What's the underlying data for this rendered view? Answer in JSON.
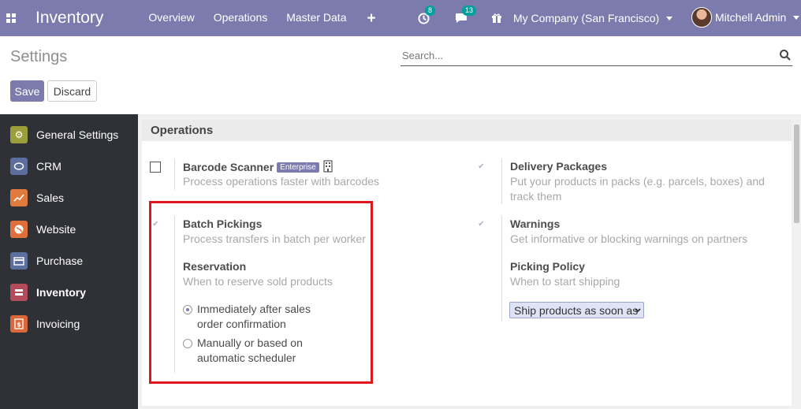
{
  "navbar": {
    "app_title": "Inventory",
    "menu": [
      "Overview",
      "Operations",
      "Master Data"
    ],
    "plus": "+",
    "activity_count": "8",
    "messages_count": "13",
    "company": "My Company (San Francisco)",
    "user": "Mitchell Admin",
    "color": "#7c7bad"
  },
  "control": {
    "title": "Settings",
    "search_placeholder": "Search...",
    "save": "Save",
    "discard": "Discard"
  },
  "sidebar": {
    "items": [
      {
        "label": "General Settings",
        "icon": "gear-icon",
        "color": "#9a9f3c"
      },
      {
        "label": "CRM",
        "icon": "handshake-icon",
        "color": "#5b6e9e"
      },
      {
        "label": "Sales",
        "icon": "chart-icon",
        "color": "#e07b3d"
      },
      {
        "label": "Website",
        "icon": "globe-icon",
        "color": "#e0703b"
      },
      {
        "label": "Purchase",
        "icon": "card-icon",
        "color": "#5a6f9d"
      },
      {
        "label": "Inventory",
        "icon": "boxes-icon",
        "color": "#b34b5b"
      },
      {
        "label": "Invoicing",
        "icon": "dollar-icon",
        "color": "#d9683a"
      }
    ]
  },
  "section": {
    "title": "Operations",
    "barcode": {
      "label": "Barcode Scanner",
      "badge": "Enterprise",
      "desc": "Process operations faster with barcodes",
      "checked": false
    },
    "delivery": {
      "label": "Delivery Packages",
      "desc": "Put your products in packs (e.g. parcels, boxes) and track them",
      "checked": true
    },
    "batch": {
      "label": "Batch Pickings",
      "desc": "Process transfers in batch per worker",
      "checked": true
    },
    "warnings": {
      "label": "Warnings",
      "desc": "Get informative or blocking warnings on partners",
      "checked": true
    },
    "reservation": {
      "label": "Reservation",
      "desc": "When to reserve sold products",
      "options": [
        {
          "line1": "Immediately after sales",
          "line2": "order confirmation",
          "selected": true
        },
        {
          "line1": "Manually or based on",
          "line2": "automatic scheduler",
          "selected": false
        }
      ]
    },
    "picking": {
      "label": "Picking Policy",
      "desc": "When to start shipping",
      "value": "Ship products as soon as"
    }
  }
}
